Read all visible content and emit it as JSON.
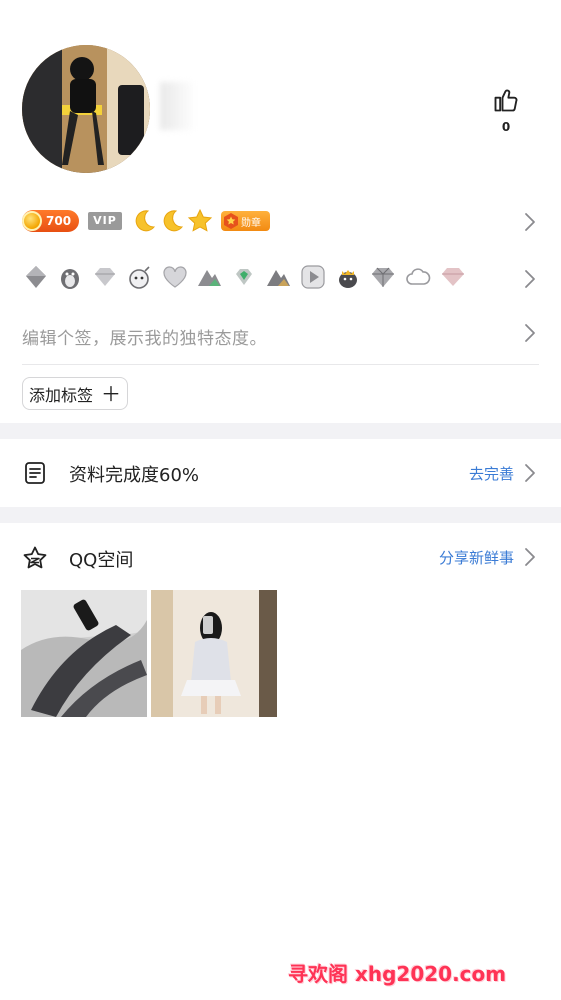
{
  "header": {
    "like_count": "0"
  },
  "badges": {
    "coin_value": "700",
    "vip_label": "VIP",
    "honor_label": "勋章",
    "level_icons": [
      "moon-icon",
      "moon-icon",
      "star-icon"
    ]
  },
  "game_icons": [
    "fish-icon",
    "penguin-icon",
    "diamond-icon",
    "bomb-icon",
    "heart-icon",
    "mountain-icon",
    "gem-icon",
    "mountain-icon",
    "play-icon",
    "crown-icon",
    "diamond-icon",
    "cloud-icon",
    "diamond-icon"
  ],
  "signature": {
    "placeholder": "编辑个签，展示我的独特态度。"
  },
  "tags": {
    "add_label": "添加标签",
    "add_symbol": "＋"
  },
  "profile_completion": {
    "title": "资料完成度60%",
    "action": "去完善"
  },
  "qzone": {
    "title": "QQ空间",
    "action": "分享新鲜事"
  },
  "watermark": "寻欢阁 xhg2020.com",
  "colors": {
    "link": "#3a7bd5",
    "coin_badge": "#e84f12",
    "vip_badge": "#9a9a9a",
    "honor_badge": "#f28a12",
    "section_gap": "#f2f2f5"
  }
}
